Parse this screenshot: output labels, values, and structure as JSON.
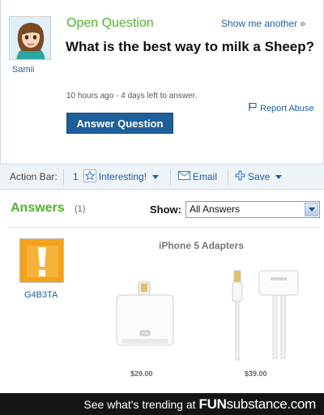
{
  "question": {
    "status_label": "Open Question",
    "show_another": "Show me another »",
    "title": "What is the best way to milk a Sheep?",
    "asker": "Samii",
    "meta": "10 hours ago - 4 days left to answer.",
    "report_abuse": "Report Abuse",
    "answer_button": "Answer Question"
  },
  "action_bar": {
    "label": "Action Bar:",
    "interesting_count": "1",
    "interesting_label": "Interesting!",
    "email_label": "Email",
    "save_label": "Save"
  },
  "answers": {
    "heading": "Answers",
    "count": "(1)",
    "show_label": "Show:",
    "show_selected": "All Answers",
    "answerer": "G4B3TA",
    "image": {
      "title": "iPhone 5 Adapters",
      "price_1": "$29.00",
      "price_2": "$39.00"
    }
  },
  "footer": {
    "text": "See what's trending at",
    "logo_bold": "FUN",
    "logo_thin": "substance",
    "logo_tld": ".com"
  },
  "colors": {
    "accent_green": "#52b12f",
    "link_blue": "#1f5fa0",
    "button_blue": "#1e5f99",
    "footer_bg": "#141414"
  }
}
